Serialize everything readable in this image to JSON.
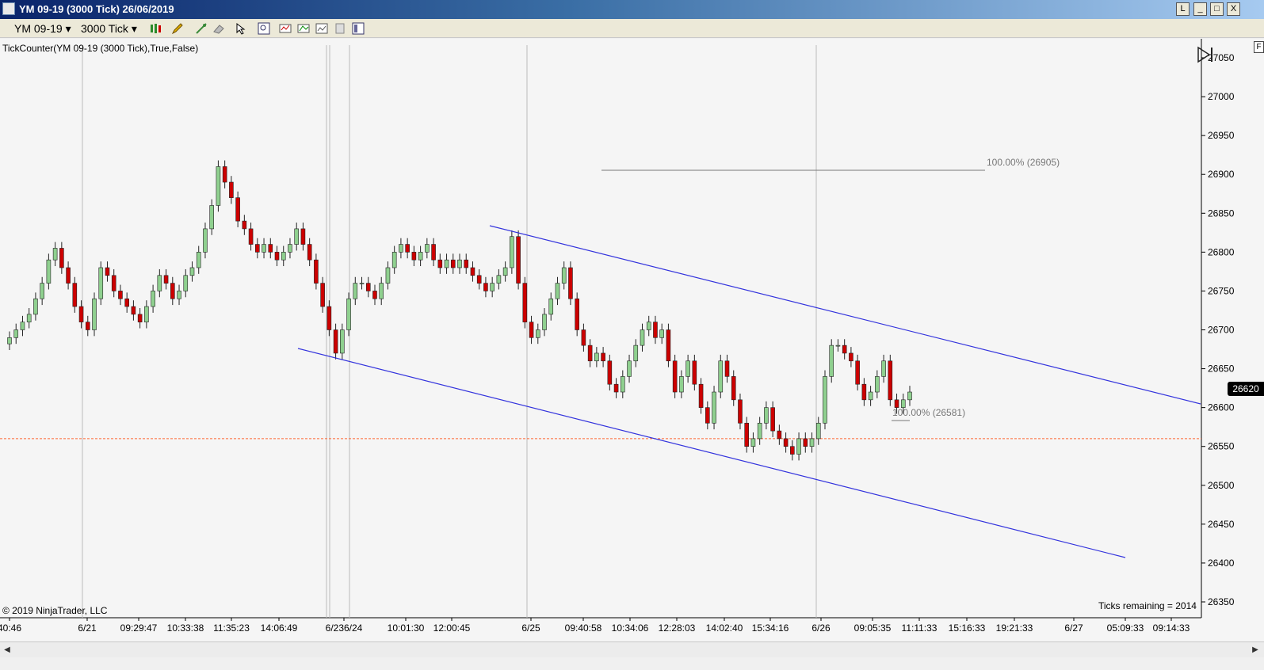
{
  "window": {
    "title": "YM 09-19 (3000 Tick)  26/06/2019",
    "buttons": [
      "L",
      "_",
      "□",
      "X"
    ]
  },
  "toolbar": {
    "instrument": "YM 09-19",
    "period": "3000 Tick",
    "icons": [
      "bar-type-icon",
      "drawing-pencil-icon",
      "drawing-tools-icon",
      "eraser-icon",
      "cursor-icon",
      "zoom-icon",
      "indicators-icon",
      "strategies-icon",
      "data-box-icon",
      "properties-icon",
      "layout-icon"
    ]
  },
  "chart": {
    "indicator_label": "TickCounter(YM  09-19  (3000  Tick),True,False)",
    "copyright": "© 2019 NinjaTrader, LLC",
    "ticks_remaining": "Ticks remaining = 2014",
    "current_price": "26620",
    "fib_top_label": "100.00% (26905)",
    "fib_bottom_label": "100.00% (26581)",
    "corner_button": "F",
    "colors": {
      "up": "#8fd08f",
      "down": "#cc0000",
      "channel": "#3333dd",
      "hline": "#ff6633",
      "fib": "#777777"
    }
  },
  "chart_data": {
    "type": "candlestick",
    "y_ticks": [
      "27050",
      "27000",
      "26950",
      "26900",
      "26850",
      "26800",
      "26750",
      "26700",
      "26650",
      "26600",
      "26550",
      "26500",
      "26450",
      "26400",
      "26350"
    ],
    "x_labels": [
      "40:46",
      "6/21",
      "09:29:47",
      "10:33:38",
      "11:35:23",
      "14:06:49",
      "6/236/24",
      "10:01:30",
      "12:00:45",
      "6/25",
      "09:40:58",
      "10:34:06",
      "12:28:03",
      "14:02:40",
      "15:34:16",
      "6/26",
      "09:05:35",
      "11:11:33",
      "15:16:33",
      "19:21:33",
      "6/27",
      "05:09:33",
      "09:14:33"
    ],
    "ylim": [
      26320,
      27075
    ],
    "horizontal_line": 26560,
    "closes": [
      26690,
      26700,
      26710,
      26720,
      26740,
      26760,
      26790,
      26805,
      26780,
      26760,
      26730,
      26710,
      26700,
      26740,
      26780,
      26770,
      26750,
      26740,
      26730,
      26720,
      26710,
      26730,
      26750,
      26770,
      26760,
      26740,
      26750,
      26770,
      26780,
      26800,
      26830,
      26860,
      26910,
      26890,
      26870,
      26840,
      26830,
      26810,
      26800,
      26810,
      26800,
      26790,
      26800,
      26810,
      26830,
      26810,
      26790,
      26760,
      26730,
      26700,
      26670,
      26700,
      26740,
      26760,
      26760,
      26750,
      26740,
      26760,
      26780,
      26800,
      26810,
      26800,
      26790,
      26800,
      26810,
      26790,
      26780,
      26790,
      26780,
      26790,
      26780,
      26770,
      26760,
      26750,
      26760,
      26770,
      26780,
      26820,
      26760,
      26710,
      26690,
      26700,
      26720,
      26740,
      26760,
      26780,
      26740,
      26700,
      26680,
      26660,
      26670,
      26660,
      26630,
      26620,
      26640,
      26660,
      26680,
      26700,
      26710,
      26690,
      26700,
      26660,
      26620,
      26640,
      26660,
      26630,
      26600,
      26580,
      26620,
      26660,
      26640,
      26610,
      26580,
      26550,
      26560,
      26580,
      26600,
      26570,
      26560,
      26550,
      26540,
      26560,
      26550,
      26560,
      26580,
      26640,
      26680,
      26680,
      26670,
      26660,
      26630,
      26610,
      26620,
      26640,
      26660,
      26610,
      26600,
      26610,
      26620
    ]
  }
}
